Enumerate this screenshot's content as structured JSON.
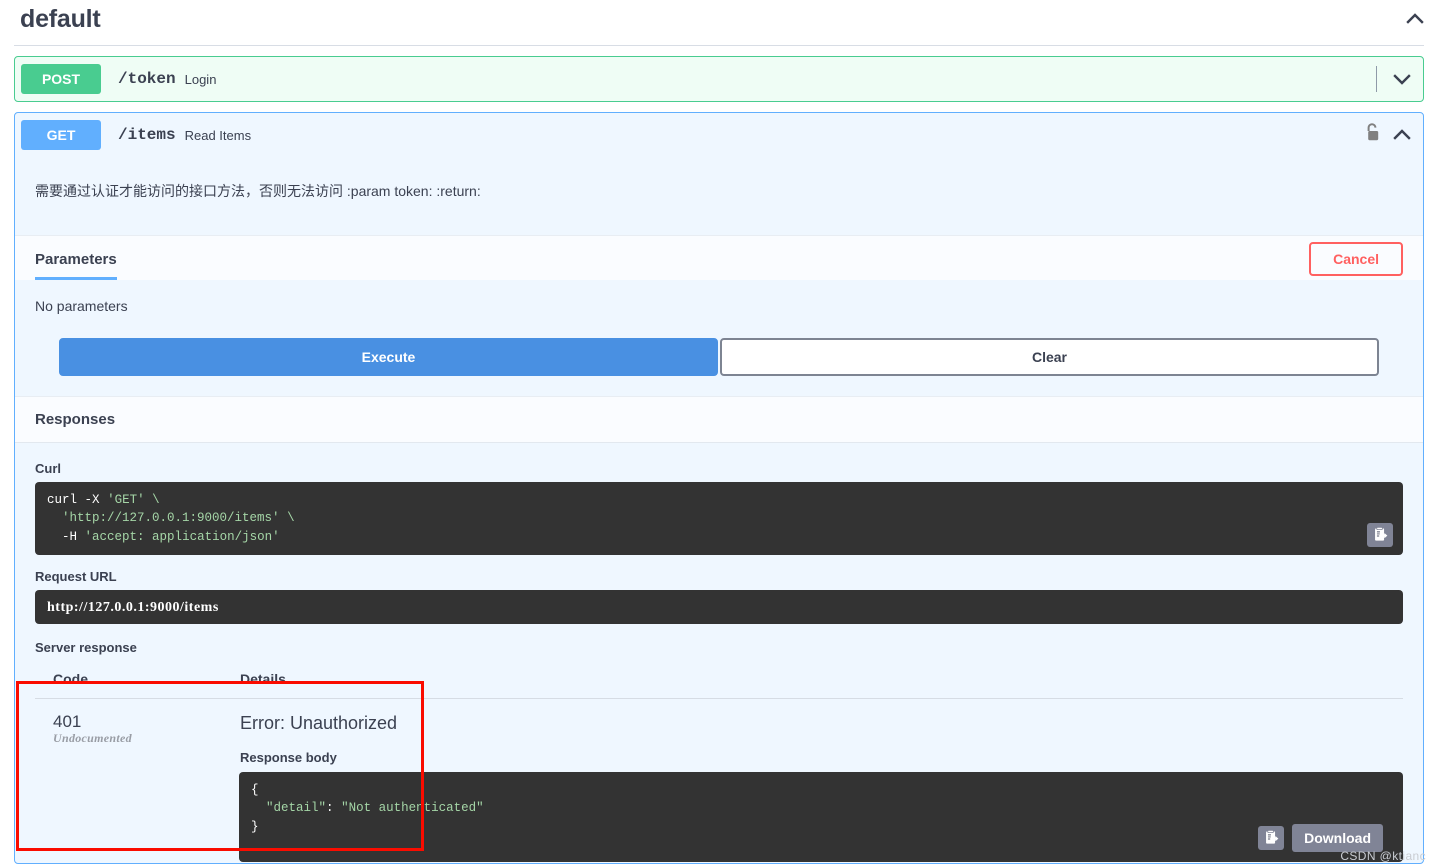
{
  "tag": {
    "title": "default",
    "collapse_icon": "chevron-up-icon"
  },
  "operations": [
    {
      "method": "POST",
      "path": "/token",
      "summary": "Login",
      "expanded": false,
      "toggle_icon": "chevron-down-icon",
      "color": "#49cc90"
    },
    {
      "method": "GET",
      "path": "/items",
      "summary": "Read Items",
      "expanded": true,
      "toggle_icon": "chevron-up-icon",
      "lock_icon": "unlocked-padlock-icon",
      "color": "#61affe",
      "description": "需要通过认证才能访问的接口方法，否则无法访问 :param token: :return:",
      "parameters": {
        "tab_label": "Parameters",
        "cancel_label": "Cancel",
        "empty_text": "No parameters"
      },
      "actions": {
        "execute_label": "Execute",
        "clear_label": "Clear"
      },
      "responses": {
        "section_label": "Responses",
        "curl_label": "Curl",
        "curl_lines": [
          "curl -X 'GET' \\",
          "  'http://127.0.0.1:9000/items' \\",
          "  -H 'accept: application/json'"
        ],
        "curl_copy_icon": "copy-to-clipboard-icon",
        "request_url_label": "Request URL",
        "request_url": "http://127.0.0.1:9000/items",
        "server_response_label": "Server response",
        "columns": [
          "Code",
          "Details"
        ],
        "rows": [
          {
            "code": "401",
            "code_note": "Undocumented",
            "error_title": "Error: Unauthorized",
            "response_body_label": "Response body",
            "response_body": "{\n  \"detail\": \"Not authenticated\"\n}",
            "copy_icon": "copy-to-clipboard-icon",
            "download_label": "Download"
          }
        ]
      }
    }
  ],
  "watermark": "CSDN @ktianc",
  "colors": {
    "post": "#49cc90",
    "get": "#61affe",
    "execute": "#4990e2",
    "cancel": "#ff6060",
    "annotation": "#fa0c00",
    "code_bg": "#333333"
  }
}
